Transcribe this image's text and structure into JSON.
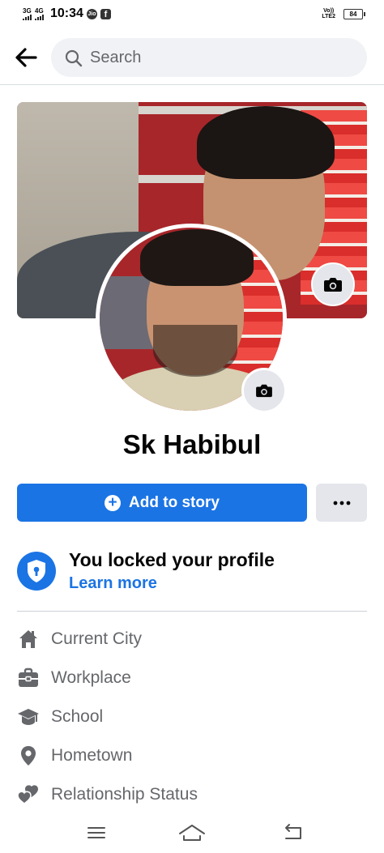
{
  "status_bar": {
    "network_1": "3G",
    "network_2": "4G",
    "time": "10:34",
    "app_icon_1": "Jio",
    "app_icon_2": "f",
    "volte_line1": "Vo))",
    "volte_line2": "LTE2",
    "battery": "84"
  },
  "header": {
    "back_icon": "arrow-left-icon",
    "search_placeholder": "Search"
  },
  "profile": {
    "name": "Sk Habibul",
    "cover_camera_icon": "camera-icon",
    "avatar_camera_icon": "camera-icon"
  },
  "actions": {
    "add_story_label": "Add to story",
    "more_label": "•••"
  },
  "lock_notice": {
    "title": "You locked your profile",
    "link": "Learn more"
  },
  "details": [
    {
      "icon": "home-icon",
      "label": "Current City"
    },
    {
      "icon": "briefcase-icon",
      "label": "Workplace"
    },
    {
      "icon": "graduation-cap-icon",
      "label": "School"
    },
    {
      "icon": "location-pin-icon",
      "label": "Hometown"
    },
    {
      "icon": "hearts-icon",
      "label": "Relationship Status"
    }
  ],
  "colors": {
    "accent": "#1b74e4",
    "secondary_text": "#65676b",
    "button_gray": "#e4e6eb"
  },
  "system_nav": [
    "menu-icon",
    "home-icon",
    "back-icon"
  ]
}
